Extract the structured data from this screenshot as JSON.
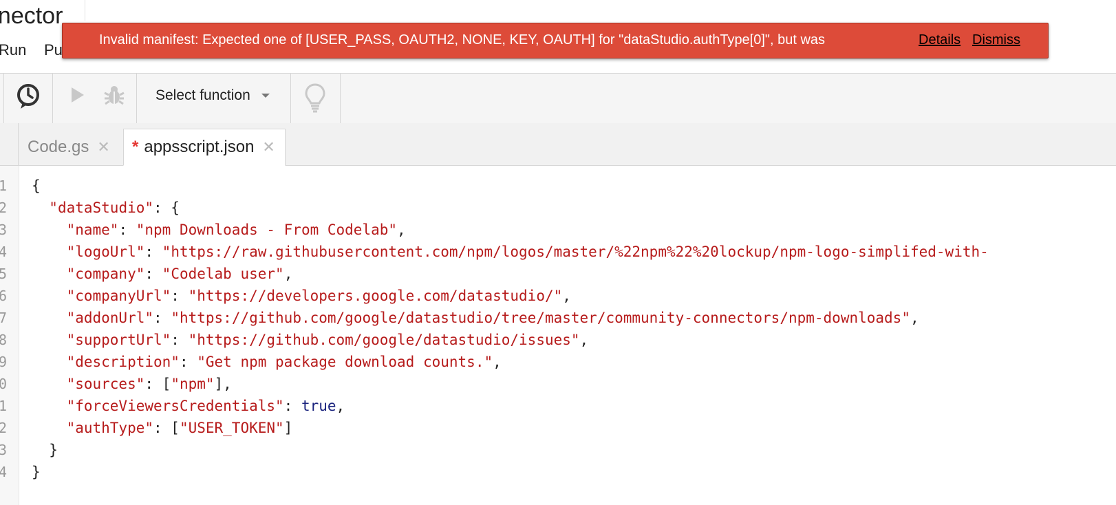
{
  "app": {
    "title": "nnector",
    "menu": [
      "Run",
      "Pu"
    ]
  },
  "banner": {
    "message": "Invalid manifest: Expected one of [USER_PASS, OAUTH2, NONE, KEY, OAUTH] for \"dataStudio.authType[0]\", but was",
    "details_label": "Details",
    "dismiss_label": "Dismiss",
    "background_color": "#dd4b39"
  },
  "toolbar": {
    "triggers_icon": "clock-icon",
    "run_icon": "play-icon",
    "debug_icon": "bug-icon",
    "select_function_label": "Select function",
    "execution_hints_icon": "lightbulb-icon"
  },
  "tabs": [
    {
      "label": "Code.gs",
      "active": false,
      "modified": false
    },
    {
      "label": "appsscript.json",
      "active": true,
      "modified": true,
      "modified_marker": "*"
    }
  ],
  "editor": {
    "line_numbers": [
      "1",
      "2",
      "3",
      "4",
      "5",
      "6",
      "7",
      "8",
      "9",
      "0",
      "1",
      "2",
      "3",
      "4"
    ],
    "lines": [
      "{",
      "  \"dataStudio\": {",
      "    \"name\": \"npm Downloads - From Codelab\",",
      "    \"logoUrl\": \"https://raw.githubusercontent.com/npm/logos/master/%22npm%22%20lockup/npm-logo-simplifed-with-",
      "    \"company\": \"Codelab user\",",
      "    \"companyUrl\": \"https://developers.google.com/datastudio/\",",
      "    \"addonUrl\": \"https://github.com/google/datastudio/tree/master/community-connectors/npm-downloads\",",
      "    \"supportUrl\": \"https://github.com/google/datastudio/issues\",",
      "    \"description\": \"Get npm package download counts.\",",
      "    \"sources\": [\"npm\"],",
      "    \"forceViewersCredentials\": true,",
      "    \"authType\": [\"USER_TOKEN\"]",
      "  }",
      "}"
    ]
  }
}
